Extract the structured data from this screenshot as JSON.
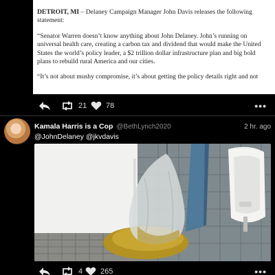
{
  "article": {
    "dateline": "DETROIT, MI",
    "intro": " – Delaney Campaign Manager John Davis releases the following statement:",
    "quote1": "“Senator Warren doesn’t know anything about John Delaney. John’s running on universal health care, creating a carbon tax and dividend that would make the United States the world’s policy leader, a $2 trillion dollar infrastructure plan and big bold plans to rebuild rural America and our cities.",
    "quote2": "“It’s not about mushy compromise, it’s about getting the policy details right and not"
  },
  "tweet1_actions": {
    "retweets": "21",
    "likes": "78",
    "more": "•••"
  },
  "tweet2": {
    "display_name": "Kamala Harris is a Cop",
    "handle": "@BethLynch2020",
    "time": "2 hr. ago",
    "text": "@JohnDelaney @jkvdavis",
    "retweets": "4",
    "likes": "265",
    "more": "•••"
  },
  "icons": {
    "reply": "reply-icon",
    "retweet": "retweet-icon",
    "like": "heart-icon",
    "more": "more-icon"
  }
}
